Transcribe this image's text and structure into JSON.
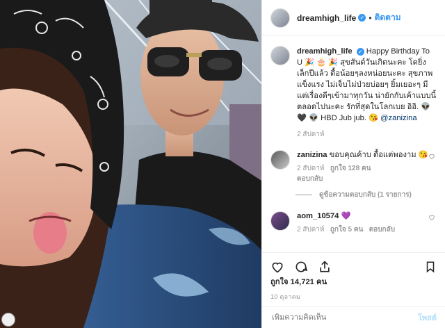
{
  "post": {
    "username": "dreamhigh_life",
    "verified_mark": "✓",
    "follow_label": "ติดตาม",
    "caption_username": "dreamhigh_life",
    "caption_text": "Happy Birthday To U 🎉 🎂 🎉 สุขสันต์วันเกิดนะคะ โดยิ่งเล็กปีแล้ว ตื้อน้อยๆลงหน่อยนะคะ สุขภาพแข็งแรง ไม่เจ็บไม่ป่วยบ่อยๆ ยิ้มเยอะๆ มีแต่เรื่องดีๆเข้ามาทุกวัน น่ายักกับเค้าแบบนี้ตลอดไปนะคะ รักที่สุดในโลกเบย อิอิ. 👽 🖤 👽 HBD Jub jub. 😘",
    "caption_mention": "@zanizina",
    "caption_time": "2 สัปดาห์",
    "likes_text": "ถูกใจ 14,721 คน",
    "date_text": "10 ตุลาคม"
  },
  "comments": [
    {
      "username": "zanizina",
      "text": "ขอบคุณค้าบ ตื้อแต่พองาม 😘",
      "time": "2 สัปดาห์",
      "likes": "ถูกใจ 128 คน",
      "reply": "ตอบกลับ",
      "view_replies": "ดูข้อความตอบกลับ (1 รายการ)"
    },
    {
      "username": "aom_10574",
      "text": "💜",
      "time": "2 สัปดาห์",
      "likes": "ถูกใจ 5 คน",
      "reply": "ตอบกลับ"
    }
  ],
  "compose": {
    "placeholder": "เพิ่มความคิดเห็น",
    "post_label": "โพสต์"
  },
  "icons": {
    "like": "heart-icon",
    "comment": "comment-icon",
    "share": "share-icon",
    "save": "bookmark-icon"
  },
  "colors": {
    "accent": "#3897f0",
    "text": "#262626",
    "muted": "#999999",
    "post_disabled": "#b2dffc"
  }
}
